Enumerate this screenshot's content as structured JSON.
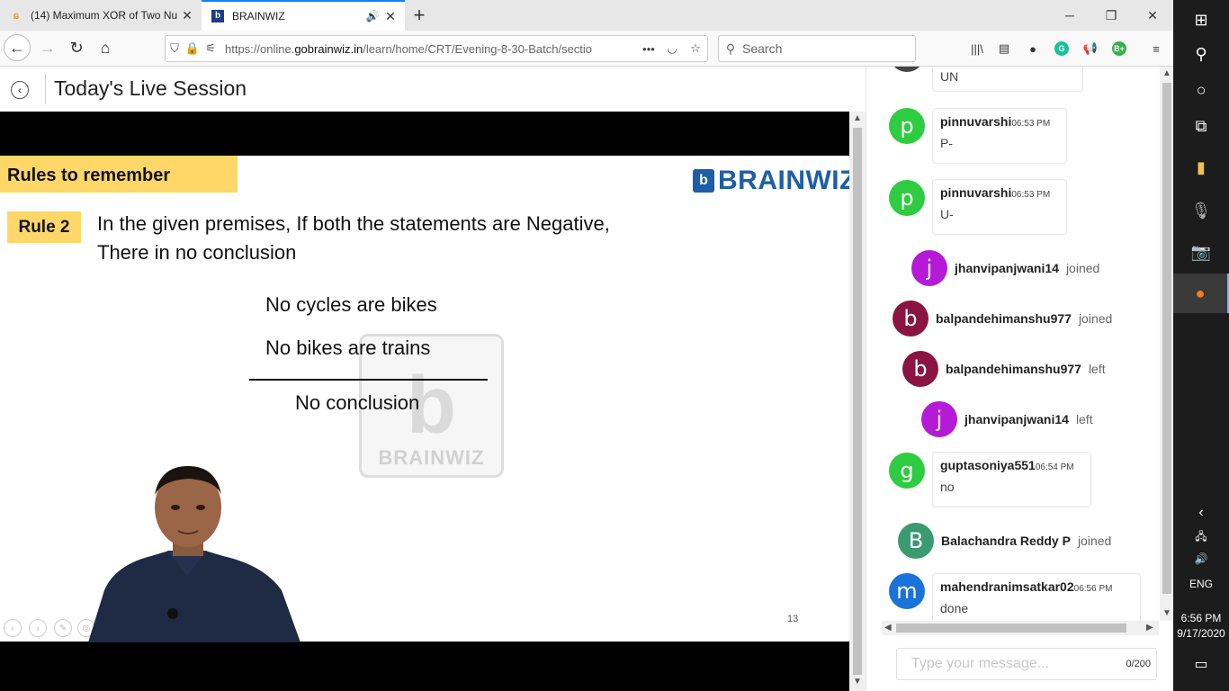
{
  "browser": {
    "tabs": [
      {
        "title": "(14) Maximum XOR of Two Nu",
        "icon": "leetcode-favicon",
        "active": false
      },
      {
        "title": "BRAINWIZ",
        "icon": "brainwiz-favicon",
        "active": true
      }
    ],
    "url_prefix": "https://online.",
    "url_domain": "gobrainwiz.in",
    "url_path": "/learn/home/CRT/Evening-8-30-Batch/sectio",
    "search_placeholder": "Search"
  },
  "page": {
    "title": "Today's Live Session"
  },
  "slide": {
    "banner": "Rules to remember",
    "logo_mark": "b",
    "logo_text": "BRAINWIZ",
    "rule_label": "Rule 2",
    "rule_line1": "In the given premises, If both the statements are Negative,",
    "rule_line2": "There in no conclusion",
    "premise1": "No cycles are bikes",
    "premise2": "No bikes are trains",
    "conclusion": "No conclusion",
    "watermark": "BRAINWIZ",
    "page_number": "13"
  },
  "chat": {
    "messages": [
      {
        "type": "message",
        "avatar": "p",
        "color": "#2ecc40",
        "name": "",
        "time": "",
        "text": "UN"
      },
      {
        "type": "message",
        "avatar": "p",
        "color": "#2ecc40",
        "name": "pinnuvarshi",
        "time": "06:53 PM",
        "text": "P-"
      },
      {
        "type": "message",
        "avatar": "p",
        "color": "#2ecc40",
        "name": "pinnuvarshi",
        "time": "06:53 PM",
        "text": "U-"
      },
      {
        "type": "event",
        "avatar": "j",
        "color": "#b51bd6",
        "name": "jhanvipanjwani14",
        "text": "joined"
      },
      {
        "type": "event",
        "avatar": "b",
        "color": "#8a1442",
        "name": "balpandehimanshu977",
        "text": "joined"
      },
      {
        "type": "event",
        "avatar": "b",
        "color": "#8a1442",
        "name": "balpandehimanshu977",
        "text": "left"
      },
      {
        "type": "event",
        "avatar": "j",
        "color": "#b51bd6",
        "name": "jhanvipanjwani14",
        "text": "left"
      },
      {
        "type": "message",
        "avatar": "g",
        "color": "#2ecc40",
        "name": "guptasoniya551",
        "time": "06:54 PM",
        "text": "no"
      },
      {
        "type": "event",
        "avatar": "B",
        "color": "#3a9a70",
        "name": "Balachandra Reddy P",
        "text": "joined"
      },
      {
        "type": "message",
        "avatar": "m",
        "color": "#1a73d9",
        "name": "mahendranimsatkar02",
        "time": "06:56 PM",
        "text": "done"
      }
    ],
    "input_placeholder": "Type your message...",
    "char_count": "0/200"
  },
  "taskbar": {
    "language": "ENG",
    "time": "6:56 PM",
    "date": "9/17/2020"
  }
}
